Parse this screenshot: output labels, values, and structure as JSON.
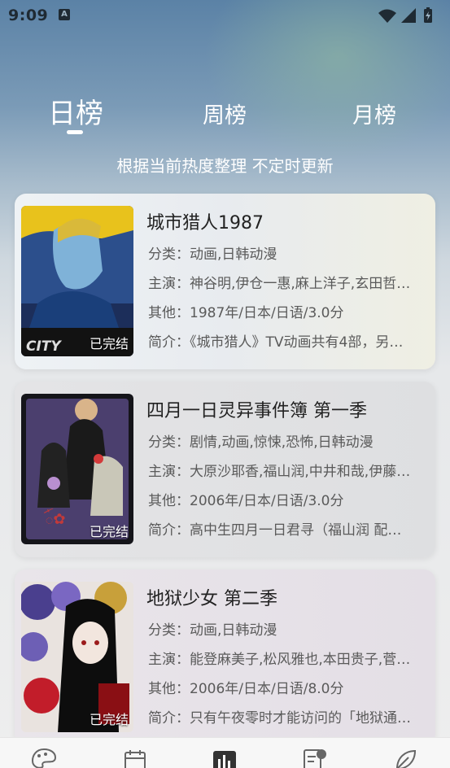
{
  "status": {
    "time": "9:09",
    "notification_letter": "A"
  },
  "tabs": [
    {
      "label": "日榜",
      "active": true
    },
    {
      "label": "周榜",
      "active": false
    },
    {
      "label": "月榜",
      "active": false
    }
  ],
  "subtitle": "根据当前热度整理 不定时更新",
  "colors": {
    "accent": "#ffffff",
    "title_text": "#222222",
    "body_text": "#5a5a5a"
  },
  "items": [
    {
      "title": "城市猎人1987",
      "status_badge": "已完结",
      "category": "分类：动画,日韩动漫",
      "cast": "主演：神谷明,伊仓一惠,麻上洋子,玄田哲…",
      "other": "其他：1987年/日本/日语/3.0分",
      "summary": "简介：《城市猎人》TV动画共有4部，另…"
    },
    {
      "title": "四月一日灵异事件簿 第一季",
      "status_badge": "已完结",
      "category": "分类：剧情,动画,惊悚,恐怖,日韩动漫",
      "cast": "主演：大原沙耶香,福山润,中井和哉,伊藤…",
      "other": "其他：2006年/日本/日语/3.0分",
      "summary": "简介：高中生四月一日君寻（福山润 配…"
    },
    {
      "title": "地狱少女 第二季",
      "status_badge": "已完结",
      "category": "分类：动画,日韩动漫",
      "cast": "主演：能登麻美子,松风雅也,本田贵子,菅…",
      "other": "其他：2006年/日本/日语/8.0分",
      "summary": "简介：只有午夜零时才能访问的「地狱通…"
    }
  ],
  "bottom_nav": [
    {
      "icon": "palette-icon"
    },
    {
      "icon": "calendar-icon"
    },
    {
      "icon": "ranking-icon",
      "active": true
    },
    {
      "icon": "document-icon"
    },
    {
      "icon": "leaf-icon"
    }
  ]
}
